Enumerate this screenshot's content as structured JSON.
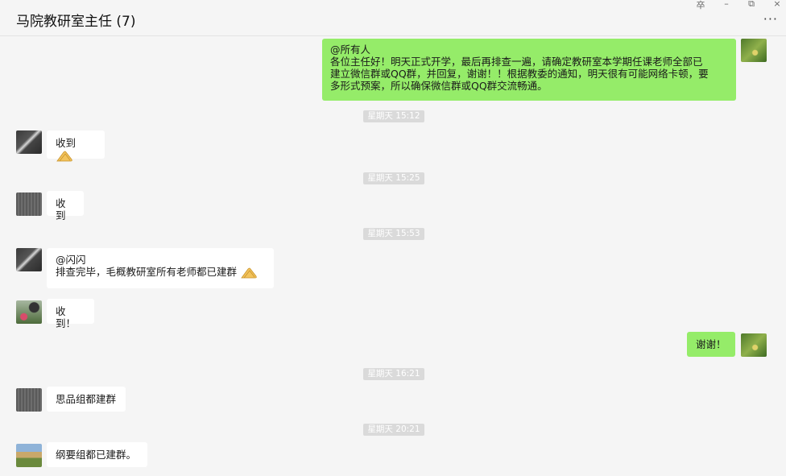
{
  "window": {
    "title": "马院教研室主任 (7)",
    "controls": {
      "pin": "卒",
      "minimize": "–",
      "restore": "⧉",
      "close": "×"
    },
    "more": "···"
  },
  "messages": [
    {
      "side": "right",
      "lines": [
        "@所有人",
        "各位主任好！明天正式开学，最后再排查一遍，请确定教研室本学期任课老师全部已",
        "建立微信群或QQ群，并回复，谢谢！！根据教委的通知，明天很有可能网络卡顿，要",
        "多形式预案，所以确保微信群或QQ群交流畅通。"
      ]
    },
    {
      "timestamp": "星期天 15:12"
    },
    {
      "side": "left",
      "text": "收到"
    },
    {
      "timestamp": "星期天 15:25"
    },
    {
      "side": "left",
      "text": "收到"
    },
    {
      "timestamp": "星期天 15:53"
    },
    {
      "side": "left",
      "lines": [
        "@闪闪",
        "排查完毕，毛概教研室所有老师都已建群"
      ]
    },
    {
      "side": "left",
      "text": "收到！"
    },
    {
      "side": "right",
      "text": "谢谢！"
    },
    {
      "timestamp": "星期天 16:21"
    },
    {
      "side": "left",
      "text": "思品组都建群"
    },
    {
      "timestamp": "星期天 20:21"
    },
    {
      "side": "left",
      "text": "纲要组都已建群。"
    }
  ],
  "icons": {
    "clapping_hands": "clapping-hands-emoji"
  },
  "colors": {
    "sent_bubble": "#95ec69",
    "received_bubble": "#ffffff",
    "background": "#f5f5f5",
    "timestamp_bg": "#dadada"
  }
}
